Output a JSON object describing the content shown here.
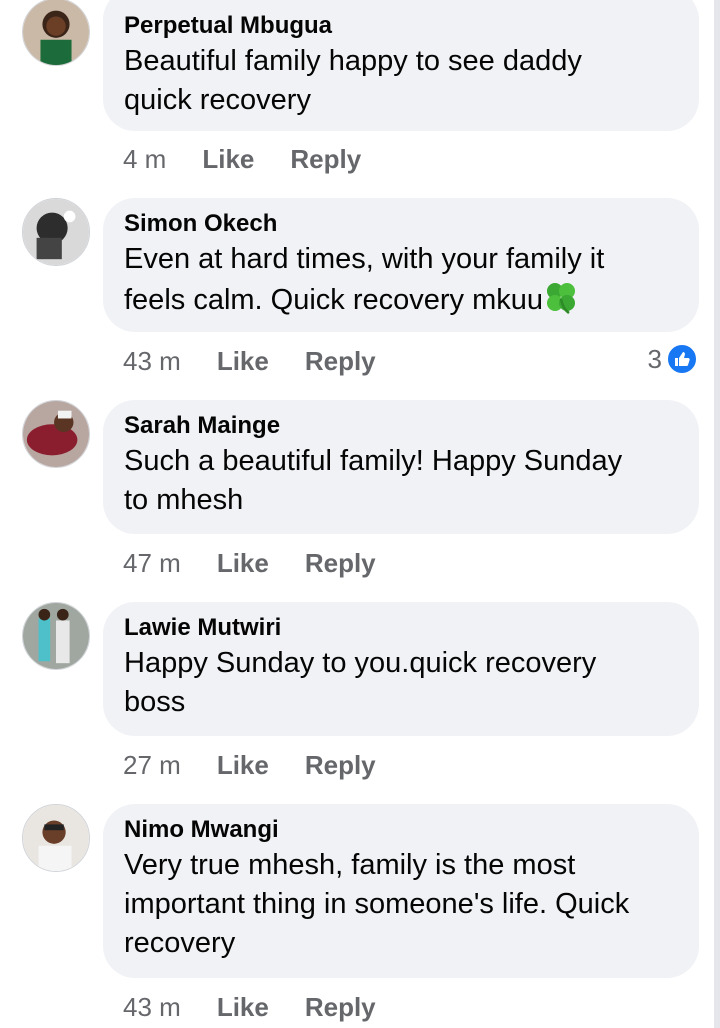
{
  "comments": [
    {
      "author": "Perpetual Mbugua",
      "lines": [
        "Beautiful family happy to see daddy",
        "quick recovery"
      ],
      "time": "4 m",
      "like_label": "Like",
      "reply_label": "Reply"
    },
    {
      "author": "Simon Okech",
      "lines": [
        "Even at hard times, with your family it",
        "feels calm. Quick recovery mkuu"
      ],
      "emoji": "four-leaf-clover-icon",
      "time": "43 m",
      "like_label": "Like",
      "reply_label": "Reply",
      "reaction_count": "3",
      "reaction_icon": "like-thumb-icon"
    },
    {
      "author": "Sarah Mainge",
      "lines": [
        "Such a beautiful family! Happy Sunday",
        "to mhesh"
      ],
      "time": "47 m",
      "like_label": "Like",
      "reply_label": "Reply"
    },
    {
      "author": "Lawie Mutwiri",
      "lines": [
        "Happy Sunday to you.quick recovery",
        "boss"
      ],
      "time": "27 m",
      "like_label": "Like",
      "reply_label": "Reply"
    },
    {
      "author": "Nimo Mwangi",
      "lines": [
        "Very true mhesh, family is the most",
        "important thing in someone's life. Quick",
        "recovery"
      ],
      "time": "43 m",
      "like_label": "Like",
      "reply_label": "Reply"
    }
  ],
  "colors": {
    "bubble": "#f0f2f5",
    "meta": "#65676b",
    "like_blue": "#1877f2"
  }
}
